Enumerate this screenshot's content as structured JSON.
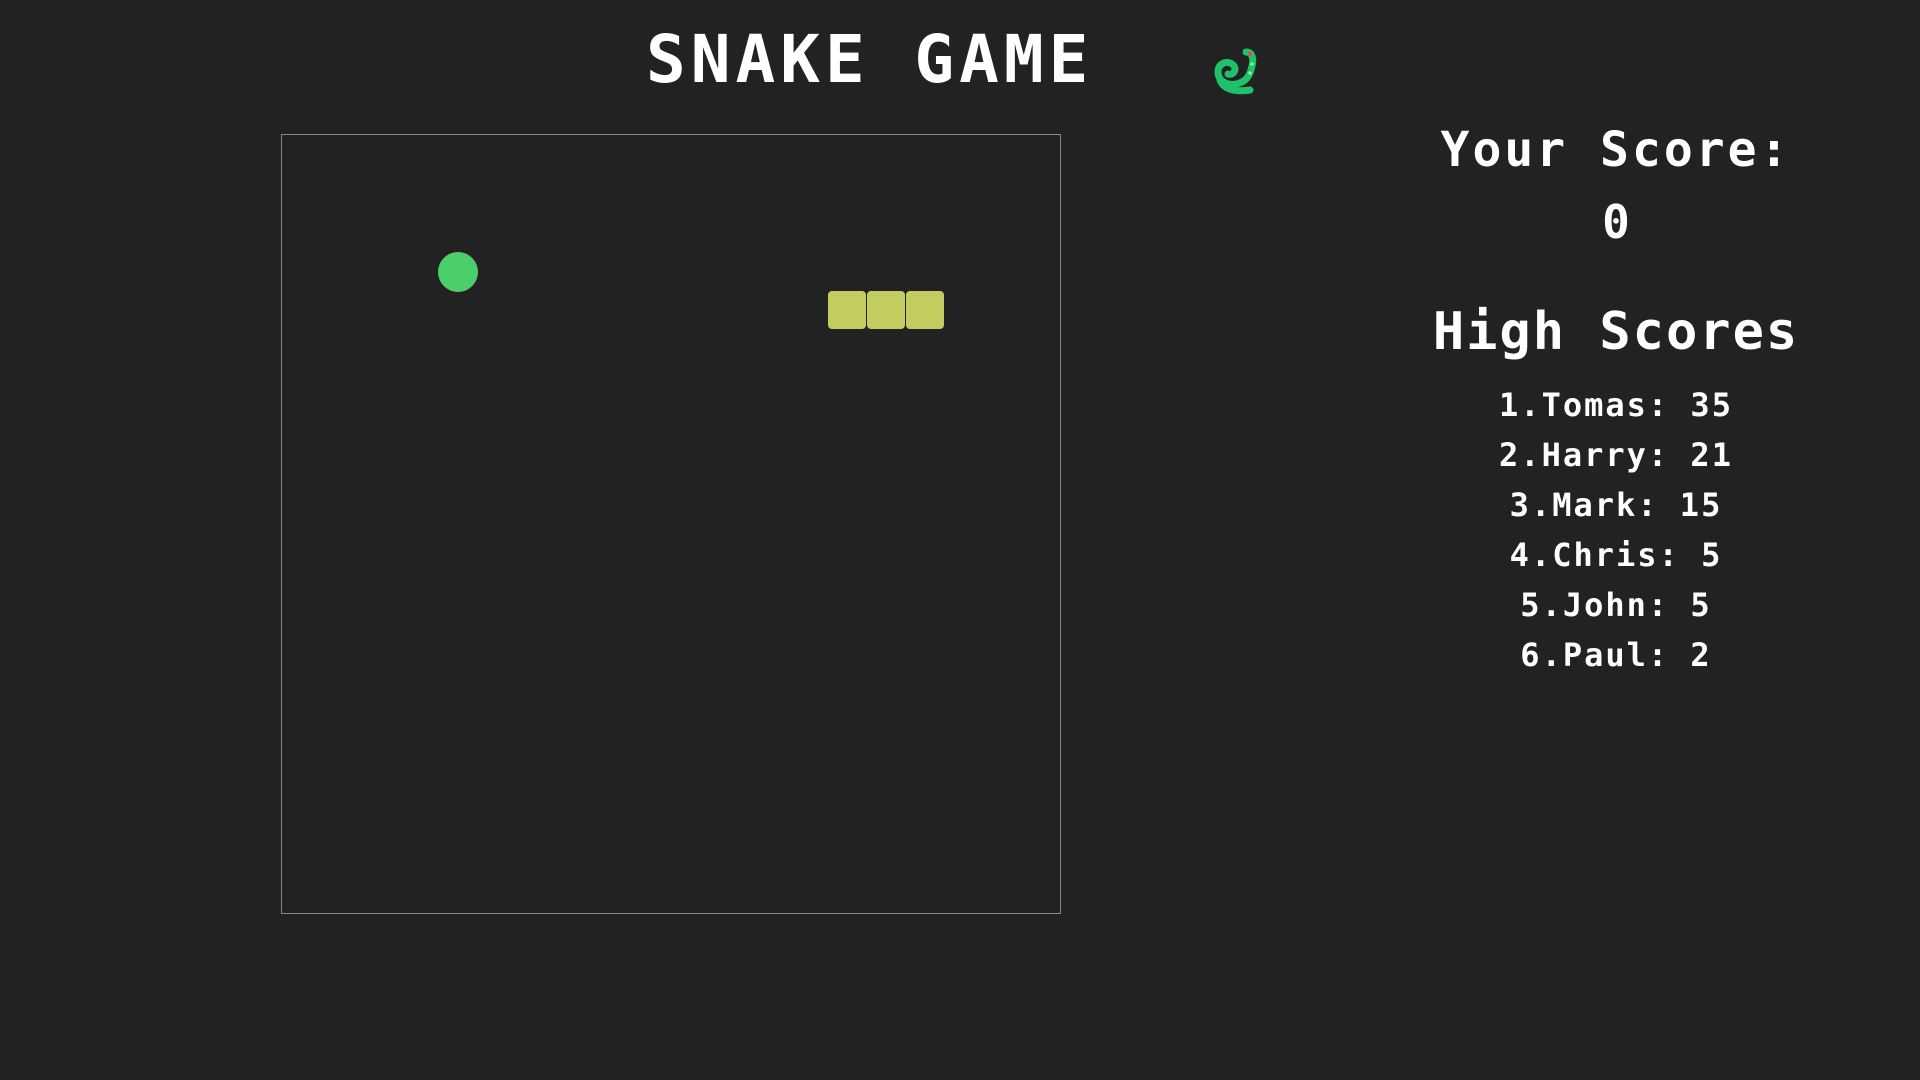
{
  "header": {
    "title": "SNAKE GAME",
    "logo_icon": "snake-icon"
  },
  "colors": {
    "background": "#222222",
    "board_border": "#888888",
    "food": "#4ccf6a",
    "snake": "#c3cc5e",
    "logo": "#1fc26b",
    "text": "#ffffff"
  },
  "score": {
    "label": "Your Score:",
    "value": "0"
  },
  "high_scores": {
    "title": "High Scores",
    "entries": [
      "1.Tomas: 35",
      "2.Harry: 21",
      "3.Mark: 15",
      "4.Chris: 5",
      "5.John: 5",
      "6.Paul: 2"
    ]
  },
  "game": {
    "grid_columns": 20,
    "grid_rows": 20,
    "food_cell": [
      4,
      3
    ],
    "snake_cells": [
      [
        14,
        4
      ],
      [
        15,
        4
      ],
      [
        16,
        4
      ]
    ]
  }
}
